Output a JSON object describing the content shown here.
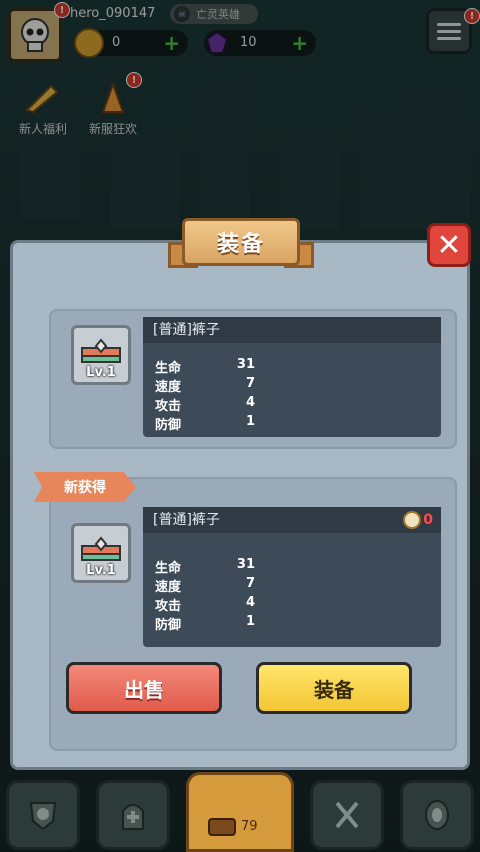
{
  "player": {
    "username": "hero_090147",
    "rank_label": "亡灵英雄"
  },
  "resources": {
    "coins": "0",
    "gems": "10"
  },
  "events": [
    {
      "label": "新人福利"
    },
    {
      "label": "新服狂欢"
    }
  ],
  "badges": {
    "avatar": "!",
    "event_carnival": "!",
    "menu": "!"
  },
  "modal": {
    "title": "装备",
    "current_item": {
      "name": "[普通]裤子",
      "level": "Lv.1",
      "stats": [
        {
          "label": "生命",
          "value": "31"
        },
        {
          "label": "速度",
          "value": "7"
        },
        {
          "label": "攻击",
          "value": "4"
        },
        {
          "label": "防御",
          "value": "1"
        }
      ]
    },
    "new_tag": "新获得",
    "new_item": {
      "name": "[普通]裤子",
      "level": "Lv.1",
      "power_delta": "0",
      "stats": [
        {
          "label": "生命",
          "value": "31"
        },
        {
          "label": "速度",
          "value": "7"
        },
        {
          "label": "攻击",
          "value": "4"
        },
        {
          "label": "防御",
          "value": "1"
        }
      ]
    },
    "sell_label": "出售",
    "equip_label": "装备"
  },
  "bottom_nav": {
    "center_count": "79"
  },
  "colors": {
    "modal_bg": "#a9b8c5",
    "sell_button": "#e96a5b",
    "equip_button": "#f8d84c",
    "close_button": "#e0463c",
    "power_negative": "#ff4b4b"
  }
}
